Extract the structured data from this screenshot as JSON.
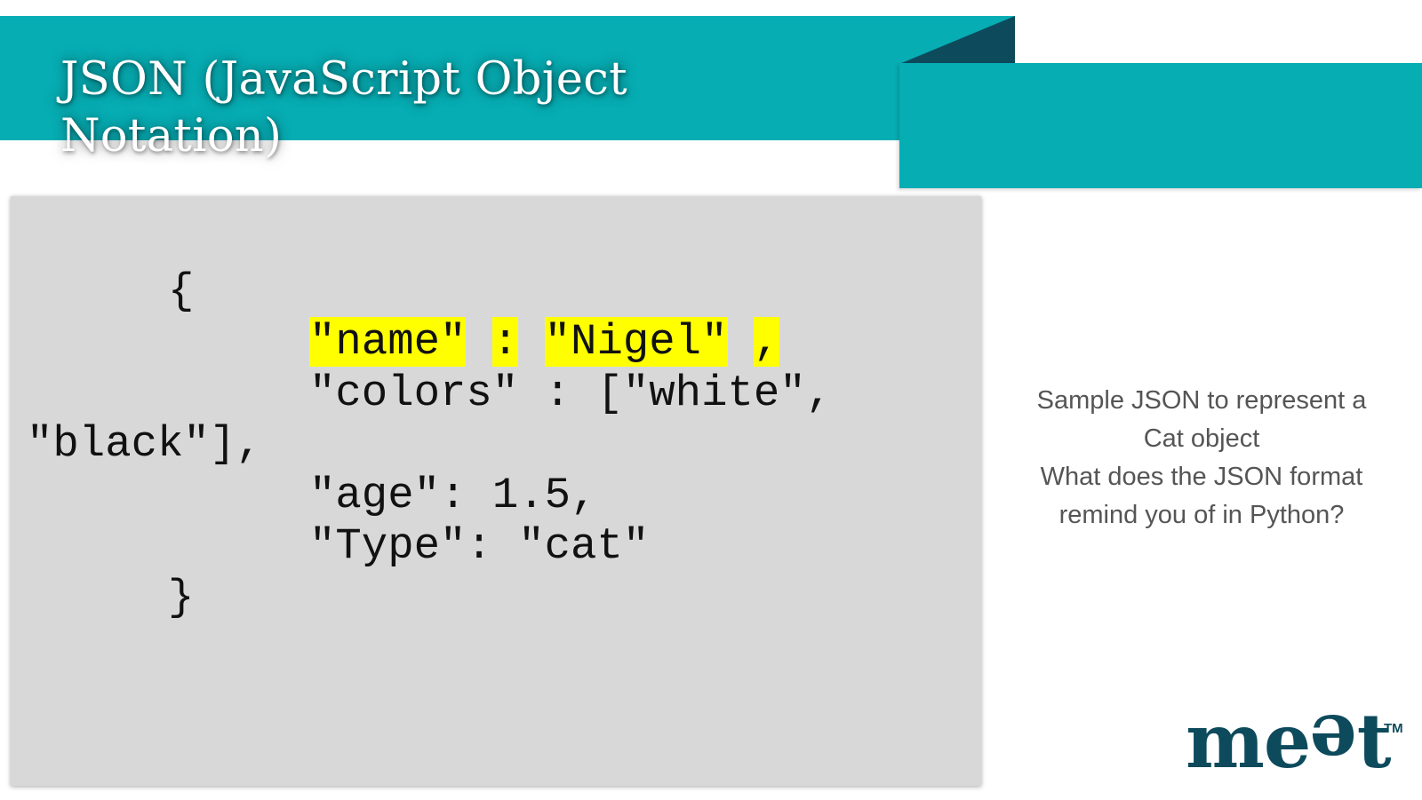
{
  "slide": {
    "title": "JSON (JavaScript Object Notation)",
    "colors": {
      "banner": "#06adb3",
      "banner_fold": "#0d4a5c",
      "code_background": "#d8d8d8",
      "highlight": "#ffff00",
      "logo": "#0d4a5c"
    }
  },
  "code": {
    "open_brace": "{",
    "name_key": "\"name\"",
    "name_colon": ":",
    "name_value": "\"Nigel\"",
    "name_comma": ",",
    "colors_line": "\"colors\" : [\"white\",",
    "black_line": "\"black\"],",
    "age_line": "\"age\": 1.5,",
    "type_line": "\"Type\": \"cat\"",
    "close_brace": "}"
  },
  "side_note": {
    "line1": "Sample JSON to represent a Cat object",
    "line2": "What does the JSON format remind you of in Python?"
  },
  "logo": {
    "text_start": "me",
    "text_rotated": "e",
    "text_end": "t",
    "trademark": "TM"
  }
}
